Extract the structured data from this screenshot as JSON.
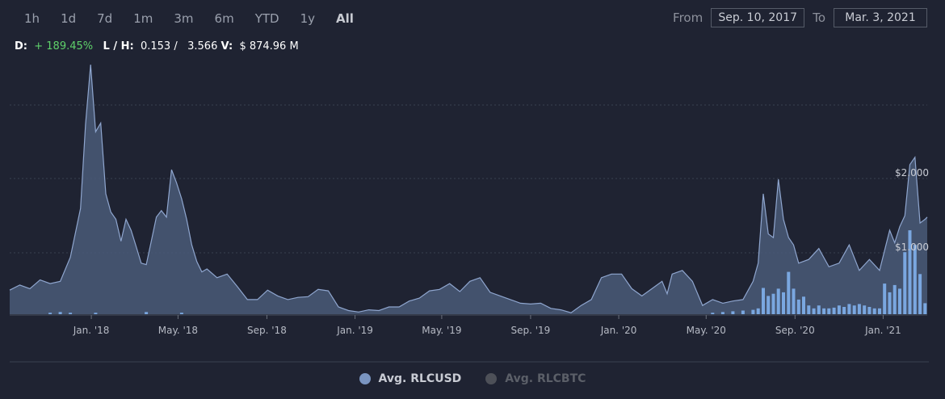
{
  "ranges": [
    "1h",
    "1d",
    "7d",
    "1m",
    "3m",
    "6m",
    "YTD",
    "1y",
    "All"
  ],
  "active_range": "All",
  "date_range": {
    "from_label": "From",
    "from_value": "Sep. 10, 2017",
    "to_label": "To",
    "to_value": "Mar. 3, 2021"
  },
  "stats": {
    "d_label": "D:",
    "d_value": "+ 189.45%",
    "lh_label": "L / H:",
    "low": "0.153 /",
    "high": "3.566",
    "v_label": "V:",
    "v_value": "$ 874.96 M"
  },
  "colors": {
    "background": "#1f2332",
    "area_fill": "#4a5b78",
    "area_line": "#8fa6cf",
    "volume": "#7aa7e0",
    "positive": "#5fd16a",
    "legend_off": "#4d5058"
  },
  "legend": [
    {
      "label": "Avg. RLCUSD",
      "color": "#7a95c1",
      "enabled": true
    },
    {
      "label": "Avg. RLCBTC",
      "color": "#4d5058",
      "enabled": false
    }
  ],
  "chart_data": {
    "type": "area",
    "x_start": "2017-09-10",
    "x_end": "2021-03-03",
    "x_ticks": [
      {
        "label": "Jan. '18",
        "date": "2018-01-01"
      },
      {
        "label": "May. '18",
        "date": "2018-05-01"
      },
      {
        "label": "Sep. '18",
        "date": "2018-09-01"
      },
      {
        "label": "Jan. '19",
        "date": "2019-01-01"
      },
      {
        "label": "May. '19",
        "date": "2019-05-01"
      },
      {
        "label": "Sep. '19",
        "date": "2019-09-01"
      },
      {
        "label": "Jan. '20",
        "date": "2020-01-01"
      },
      {
        "label": "May. '20",
        "date": "2020-05-01"
      },
      {
        "label": "Sep. '20",
        "date": "2020-09-01"
      },
      {
        "label": "Jan. '21",
        "date": "2021-01-01"
      }
    ],
    "y_ticks": [
      {
        "label": "$1.000",
        "value": 1
      },
      {
        "label": "$2.000",
        "value": 2
      }
    ],
    "ylim": [
      0,
      3.42
    ],
    "grid": true,
    "series": [
      {
        "name": "Avg. RLCUSD",
        "x": [
          "2017-09-10",
          "2017-09-24",
          "2017-10-08",
          "2017-10-22",
          "2017-11-05",
          "2017-11-19",
          "2017-12-03",
          "2017-12-17",
          "2017-12-24",
          "2017-12-31",
          "2018-01-07",
          "2018-01-14",
          "2018-01-21",
          "2018-01-28",
          "2018-02-04",
          "2018-02-11",
          "2018-02-18",
          "2018-02-25",
          "2018-03-04",
          "2018-03-11",
          "2018-03-18",
          "2018-03-25",
          "2018-04-01",
          "2018-04-08",
          "2018-04-15",
          "2018-04-22",
          "2018-04-29",
          "2018-05-06",
          "2018-05-13",
          "2018-05-20",
          "2018-05-27",
          "2018-06-03",
          "2018-06-10",
          "2018-06-24",
          "2018-07-08",
          "2018-07-22",
          "2018-08-05",
          "2018-08-19",
          "2018-09-02",
          "2018-09-16",
          "2018-09-30",
          "2018-10-14",
          "2018-10-28",
          "2018-11-11",
          "2018-11-25",
          "2018-12-09",
          "2018-12-23",
          "2019-01-06",
          "2019-01-20",
          "2019-02-03",
          "2019-02-17",
          "2019-03-03",
          "2019-03-17",
          "2019-03-31",
          "2019-04-14",
          "2019-04-28",
          "2019-05-12",
          "2019-05-26",
          "2019-06-09",
          "2019-06-23",
          "2019-07-07",
          "2019-07-21",
          "2019-08-04",
          "2019-08-18",
          "2019-09-01",
          "2019-09-15",
          "2019-09-29",
          "2019-10-13",
          "2019-10-27",
          "2019-11-10",
          "2019-11-24",
          "2019-12-08",
          "2019-12-22",
          "2020-01-05",
          "2020-01-19",
          "2020-02-02",
          "2020-02-16",
          "2020-03-01",
          "2020-03-08",
          "2020-03-15",
          "2020-03-29",
          "2020-04-12",
          "2020-04-26",
          "2020-05-10",
          "2020-05-24",
          "2020-06-07",
          "2020-06-21",
          "2020-07-05",
          "2020-07-12",
          "2020-07-19",
          "2020-07-26",
          "2020-08-02",
          "2020-08-09",
          "2020-08-16",
          "2020-08-23",
          "2020-08-30",
          "2020-09-06",
          "2020-09-20",
          "2020-10-04",
          "2020-10-18",
          "2020-11-01",
          "2020-11-15",
          "2020-11-29",
          "2020-12-13",
          "2020-12-27",
          "2021-01-10",
          "2021-01-17",
          "2021-01-24",
          "2021-01-31",
          "2021-02-07",
          "2021-02-14",
          "2021-02-21",
          "2021-02-28",
          "2021-03-03"
        ],
        "y": [
          0.33,
          0.4,
          0.35,
          0.47,
          0.42,
          0.45,
          0.78,
          1.45,
          2.6,
          3.42,
          2.5,
          2.62,
          1.65,
          1.4,
          1.3,
          1.0,
          1.3,
          1.15,
          0.93,
          0.7,
          0.68,
          1.0,
          1.33,
          1.42,
          1.33,
          1.98,
          1.8,
          1.58,
          1.3,
          0.95,
          0.72,
          0.58,
          0.62,
          0.5,
          0.55,
          0.38,
          0.2,
          0.2,
          0.33,
          0.25,
          0.2,
          0.23,
          0.24,
          0.34,
          0.32,
          0.1,
          0.05,
          0.03,
          0.06,
          0.05,
          0.1,
          0.1,
          0.18,
          0.22,
          0.32,
          0.34,
          0.42,
          0.31,
          0.45,
          0.5,
          0.3,
          0.25,
          0.2,
          0.15,
          0.14,
          0.15,
          0.08,
          0.06,
          0.02,
          0.12,
          0.2,
          0.5,
          0.55,
          0.55,
          0.35,
          0.25,
          0.35,
          0.45,
          0.28,
          0.55,
          0.6,
          0.45,
          0.12,
          0.2,
          0.15,
          0.18,
          0.2,
          0.45,
          0.7,
          1.65,
          1.1,
          1.05,
          1.85,
          1.3,
          1.05,
          0.95,
          0.7,
          0.75,
          0.9,
          0.65,
          0.7,
          0.95,
          0.6,
          0.75,
          0.6,
          1.15,
          0.98,
          1.2,
          1.35,
          2.05,
          2.15,
          1.25,
          1.3,
          1.33
        ]
      },
      {
        "name": "Volume",
        "x": [
          "2017-11-05",
          "2017-11-19",
          "2017-12-03",
          "2018-01-07",
          "2018-03-18",
          "2018-05-06",
          "2020-05-10",
          "2020-05-24",
          "2020-06-07",
          "2020-06-21",
          "2020-07-05",
          "2020-07-12",
          "2020-07-19",
          "2020-07-26",
          "2020-08-02",
          "2020-08-09",
          "2020-08-16",
          "2020-08-23",
          "2020-08-30",
          "2020-09-06",
          "2020-09-13",
          "2020-09-20",
          "2020-09-27",
          "2020-10-04",
          "2020-10-11",
          "2020-10-18",
          "2020-10-25",
          "2020-11-01",
          "2020-11-08",
          "2020-11-15",
          "2020-11-22",
          "2020-11-29",
          "2020-12-06",
          "2020-12-13",
          "2020-12-20",
          "2020-12-27",
          "2021-01-03",
          "2021-01-10",
          "2021-01-17",
          "2021-01-24",
          "2021-01-31",
          "2021-02-07",
          "2021-02-14",
          "2021-02-21",
          "2021-02-28"
        ],
        "values": [
          0.02,
          0.03,
          0.02,
          0.02,
          0.03,
          0.02,
          0.02,
          0.03,
          0.04,
          0.05,
          0.06,
          0.08,
          0.36,
          0.25,
          0.28,
          0.35,
          0.3,
          0.58,
          0.35,
          0.2,
          0.24,
          0.12,
          0.08,
          0.12,
          0.08,
          0.08,
          0.09,
          0.12,
          0.1,
          0.14,
          0.12,
          0.14,
          0.12,
          0.1,
          0.08,
          0.08,
          0.42,
          0.3,
          0.4,
          0.35,
          0.85,
          1.15,
          0.95,
          0.55,
          0.15
        ]
      }
    ]
  }
}
